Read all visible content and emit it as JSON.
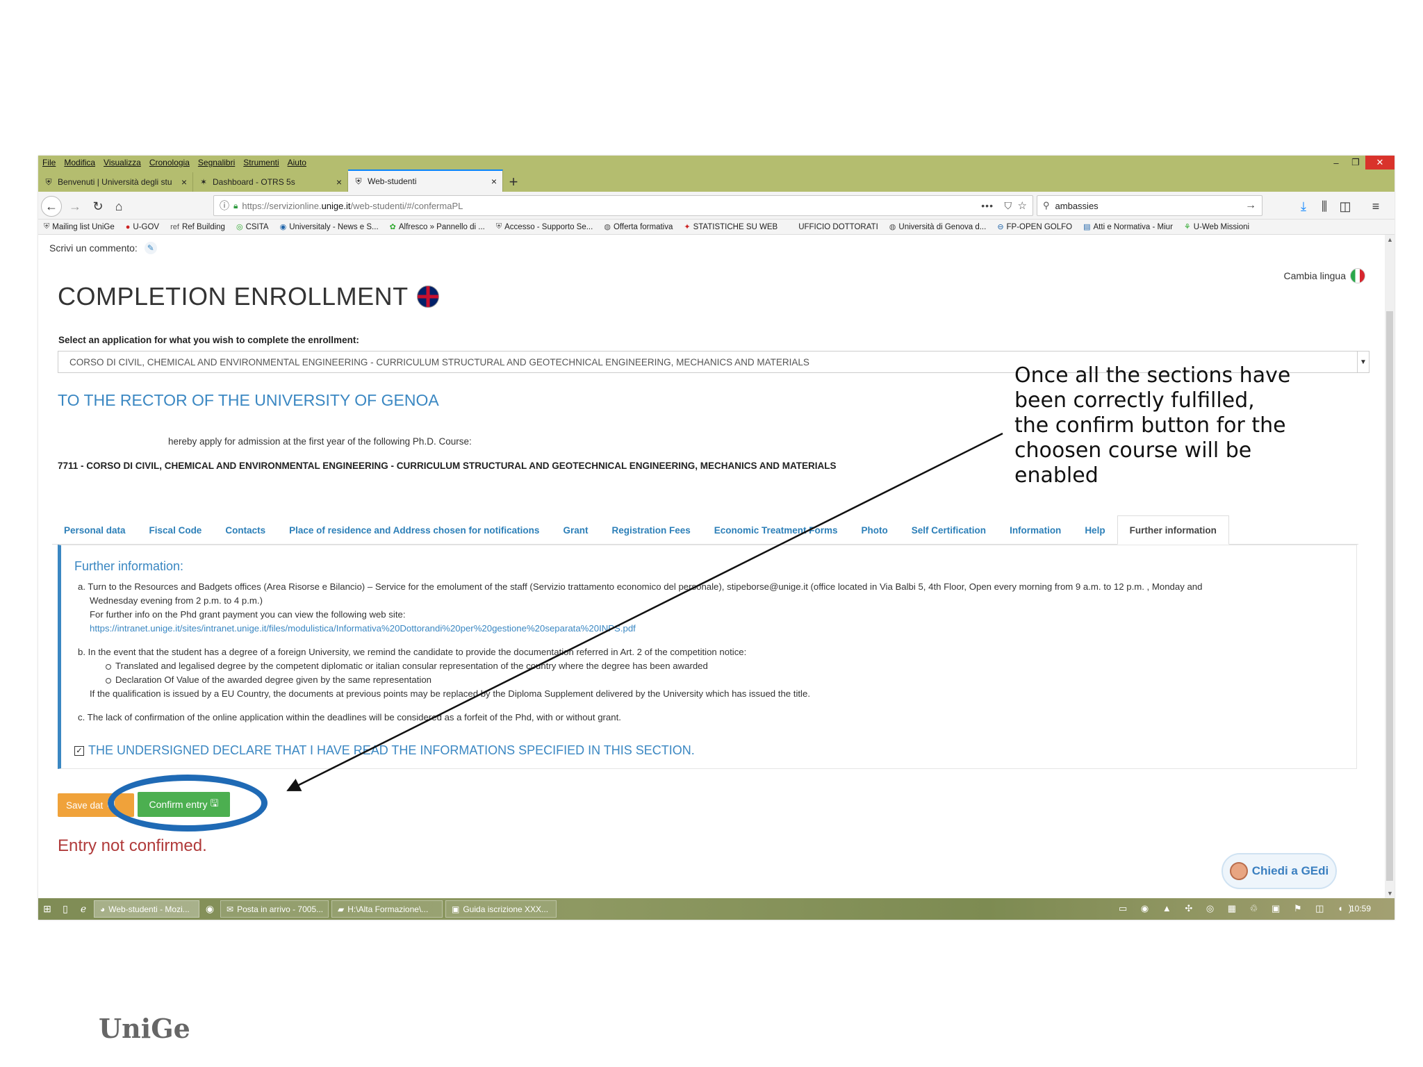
{
  "menubar": {
    "items": [
      "File",
      "Modifica",
      "Visualizza",
      "Cronologia",
      "Segnalibri",
      "Strumenti",
      "Aiuto"
    ]
  },
  "tabs": [
    {
      "label": "Benvenuti | Università degli stu",
      "icon": "shield-icon"
    },
    {
      "label": "Dashboard - OTRS 5s",
      "icon": "otrs-icon"
    },
    {
      "label": "Web-studenti",
      "icon": "shield-icon",
      "active": true
    }
  ],
  "address": {
    "url_prefix": "https://servizionline.",
    "url_domain": "unige.it",
    "url_path": "/web-studenti/#/confermaPL"
  },
  "search": {
    "value": "ambassies"
  },
  "bookmarks": [
    "Mailing list UniGe",
    "U-GOV",
    "Ref Building",
    "CSITA",
    "Universitaly - News e S...",
    "Alfresco » Pannello di ...",
    "Accesso - Supporto Se...",
    "Offerta formativa",
    "STATISTICHE SU WEB",
    "UFFICIO DOTTORATI",
    "Università di Genova d...",
    "FP-OPEN GOLFO",
    "Atti e Normativa - Miur",
    "U-Web Missioni"
  ],
  "page": {
    "comment_label": "Scrivi un commento:",
    "lang_label": "Cambia lingua",
    "title": "COMPLETION ENROLLMENT",
    "select_label": "Select an application for what you wish to complete the enrollment:",
    "select_value": "CORSO DI CIVIL, CHEMICAL AND ENVIRONMENTAL ENGINEERING - CURRICULUM STRUCTURAL AND GEOTECHNICAL ENGINEERING, MECHANICS AND MATERIALS",
    "rector_heading": "TO THE RECTOR OF THE UNIVERSITY OF GENOA",
    "apply_text": "hereby apply for admission at the first year of the following Ph.D. Course:",
    "course_code": "7711 - CORSO DI CIVIL, CHEMICAL AND ENVIRONMENTAL ENGINEERING - CURRICULUM STRUCTURAL AND GEOTECHNICAL ENGINEERING, MECHANICS AND MATERIALS"
  },
  "page_tabs": [
    "Personal data",
    "Fiscal Code",
    "Contacts",
    "Place of residence and Address chosen for notifications",
    "Grant",
    "Registration Fees",
    "Economic Treatment Forms",
    "Photo",
    "Self Certification",
    "Information",
    "Help",
    "Further information"
  ],
  "info": {
    "title": "Further information:",
    "a_line1": "a.  Turn to the Resources and Badgets offices (Area Risorse e Bilancio) – Service for the emolument of the staff (Servizio trattamento economico del personale), stipeborse@unige.it (office located in Via Balbi 5, 4th Floor, Open every morning from 9 a.m. to 12 p.m. , Monday and",
    "a_line2": "Wednesday evening from 2 p.m. to 4 p.m.)",
    "a_line3": "For further info on the Phd grant payment you can view the following web site:",
    "a_link": "https://intranet.unige.it/sites/intranet.unige.it/files/modulistica/Informativa%20Dottorandi%20per%20gestione%20separata%20INPS.pdf",
    "b_line1": "b.  In the event that the student has a degree of a foreign University, we remind the candidate to provide the documentation referred in Art. 2 of the competition notice:",
    "b_sub1": "Translated and legalised degree by the competent diplomatic or italian consular representation of the country where the degree has been awarded",
    "b_sub2": "Declaration Of Value of the awarded degree given by the same representation",
    "b_line4": "If the qualification is issued by a EU Country, the documents at previous points may be replaced by the Diploma Supplement delivered by the University which has issued the title.",
    "c_line1": "c.  The lack of confirmation of the online application within the deadlines will be considered as a forfeit of the Phd, with or without grant.",
    "declare": "THE UNDERSIGNED DECLARE THAT I HAVE READ THE INFORMATIONS SPECIFIED IN THIS SECTION."
  },
  "actions": {
    "save_label": "Save dat",
    "confirm_label": "Confirm entry",
    "status": "Entry not confirmed.",
    "chat_label": "Chiedi a GEdi"
  },
  "taskbar": {
    "items": [
      "Web-studenti - Mozi...",
      "Posta in arrivo - 7005...",
      "H:\\Alta Formazione\\...",
      "Guida iscrizione XXX..."
    ],
    "clock": "10:59"
  },
  "annotation": {
    "callout": "Once all the sections have\nbeen correctly fulfilled,\nthe confirm button for the\nchoosen course will be\nenabled",
    "logo": "UniGe"
  },
  "colors": {
    "accent": "#3a87c2",
    "confirm": "#4caf50",
    "save": "#f0a23a",
    "highlight": "#1f6ab5",
    "error": "#b03a3a"
  }
}
